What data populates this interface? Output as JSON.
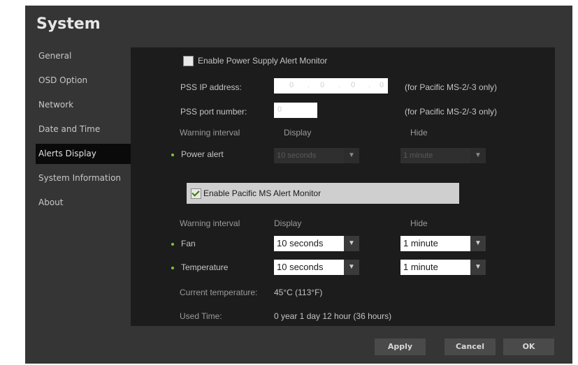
{
  "window": {
    "title": "System"
  },
  "sidebar": {
    "items": [
      {
        "label": "General",
        "active": false
      },
      {
        "label": "OSD Option",
        "active": false
      },
      {
        "label": "Network",
        "active": false
      },
      {
        "label": "Date and Time",
        "active": false
      },
      {
        "label": "Alerts Display",
        "active": true
      },
      {
        "label": "System Information",
        "active": false
      },
      {
        "label": "About",
        "active": false
      }
    ]
  },
  "power_supply": {
    "enable_label": "Enable Power Supply Alert Monitor",
    "enabled": false,
    "ip_label": "PSS IP address:",
    "ip_segments": [
      "0",
      "0",
      "0",
      "0"
    ],
    "ip_note": "(for Pacific MS-2/-3 only)",
    "port_label": "PSS port number:",
    "port_value": "0",
    "port_note": "(for Pacific MS-2/-3 only)",
    "warning_label": "Warning interval",
    "display_header": "Display",
    "hide_header": "Hide",
    "power_alert_label": "Power alert",
    "power_display": "10 seconds",
    "power_hide": "1 minute"
  },
  "pacific": {
    "enable_label": "Enable Pacific MS Alert Monitor",
    "enabled": true,
    "warning_label": "Warning interval",
    "display_header": "Display",
    "hide_header": "Hide",
    "fan_label": "Fan",
    "fan_display": "10 seconds",
    "fan_hide": "1 minute",
    "temp_label": "Temperature",
    "temp_display": "10 seconds",
    "temp_hide": "1 minute",
    "current_temp_label": "Current temperature:",
    "current_temp_value": "45°C  (113°F)",
    "used_time_label": "Used Time:",
    "used_time_value": "0 year  1 day  12 hour (36 hours)"
  },
  "buttons": {
    "apply": "Apply",
    "cancel": "Cancel",
    "ok": "OK"
  },
  "icons": {
    "dropdown": "chevron-down-icon",
    "check": "check-icon",
    "status_dot": "status-dot-icon"
  },
  "colors": {
    "accent": "#7acb2e",
    "background": "#353535",
    "panel": "#1c1c1c"
  }
}
